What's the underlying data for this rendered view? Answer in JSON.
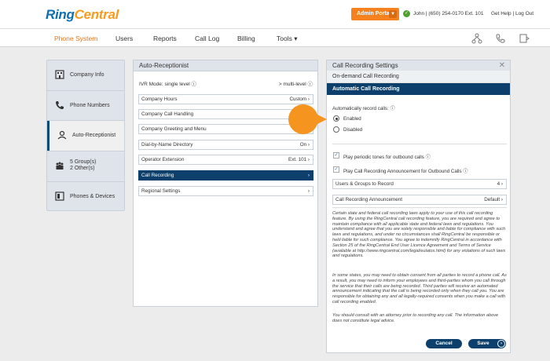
{
  "header": {
    "logo_ring": "Ring",
    "logo_central": "Central",
    "admin_portal": "Admin Portal",
    "user": "John | (650) 254-0170 Ext. 101",
    "links": "Get Help | Log Out"
  },
  "nav": {
    "items": [
      "Phone System",
      "Users",
      "Reports",
      "Call Log",
      "Billing",
      "Tools ▾"
    ],
    "active_color": "#e8741a"
  },
  "sidebar": {
    "items": [
      {
        "label": "Company Info",
        "icon": "building-icon"
      },
      {
        "label": "Phone Numbers",
        "icon": "phone-icon"
      },
      {
        "label": "Auto-Receptionist",
        "icon": "receptionist-icon"
      },
      {
        "label": "5 Group(s)",
        "label2": "2 Other(s)",
        "icon": "groups-icon"
      },
      {
        "label": "Phones & Devices",
        "icon": "device-icon"
      }
    ]
  },
  "auto_receptionist": {
    "title": "Auto-Receptionist",
    "ivr_mode": "IVR Mode: single level",
    "ivr_switch": "> multi-level",
    "rows": [
      {
        "label": "Company Hours",
        "value": "Custom ›"
      },
      {
        "label": "Company Call Handling",
        "value": ""
      },
      {
        "label": "Company Greeting and Menu",
        "value": ""
      },
      {
        "label": "Dial-by-Name Directory",
        "value": "On ›"
      },
      {
        "label": "Operator Extension",
        "value": "Ext. 101 ›"
      },
      {
        "label": "Call Recording",
        "value": "›"
      },
      {
        "label": "Regional Settings",
        "value": "›"
      }
    ]
  },
  "call_recording": {
    "title": "Call Recording Settings",
    "on_demand": "On-demand Call Recording",
    "automatic": "Automatic Call Recording",
    "auto_label": "Automatically record calls:",
    "enabled": "Enabled",
    "disabled": "Disabled",
    "periodic_tones": "Play periodic tones for outbound calls",
    "announcement_outbound": "Play Call Recording Announcement for Outbound Calls",
    "users_groups": "Users & Groups to Record",
    "users_groups_value": "4 ›",
    "announcement": "Call Recording Announcement",
    "announcement_value": "Default ›",
    "legal1": "Certain state and federal call recording laws apply to your use of this call recording feature. By using the RingCentral call recording feature, you are required and agree to maintain compliance with all applicable state and federal laws and regulations. You understand and agree that you are solely responsible and liable for compliance with such laws and regulations, and under no circumstances shall RingCentral be responsible or held liable for such compliance. You agree to indemnify RingCentral in accordance with Section 25 of the RingCentral End User Licence Agreement and Terms of Service (available at http://www.ringcentral.com/legal/eulatos.html) for any violations of such laws and regulations.",
    "legal2": "In some states, you may need to obtain consent from all parties to record a phone call. As a result, you may need to inform your employees and third-parties whom you call through the service that their calls are being recorded. Third parties will receive an automated announcement indicating that the call is being recorded only when they call you. You are responsible for obtaining any and all legally-required consents when you make a call with call recording enabled.",
    "legal3": "You should consult with an attorney prior to recording any call. The information above does not constitute legal advice.",
    "cancel": "Cancel",
    "save": "Save"
  }
}
